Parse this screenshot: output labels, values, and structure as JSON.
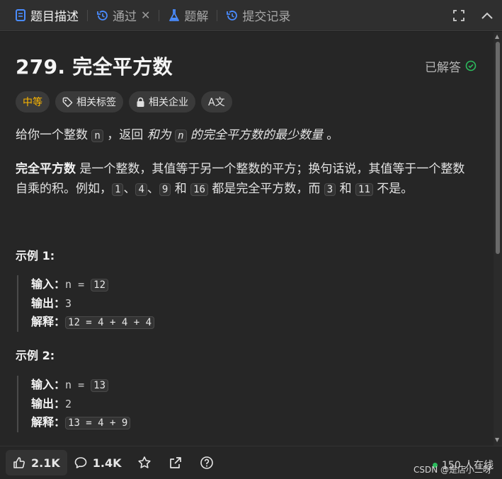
{
  "tabs": [
    {
      "label": "题目描述",
      "icon": "document-icon",
      "active": true
    },
    {
      "label": "通过",
      "icon": "history-icon",
      "active": false
    },
    {
      "label": "题解",
      "icon": "flask-icon",
      "active": false
    },
    {
      "label": "提交记录",
      "icon": "history-icon",
      "active": false
    }
  ],
  "problem": {
    "title": "279. 完全平方数",
    "status": "已解答",
    "tags": [
      {
        "label": "中等",
        "icon": null
      },
      {
        "label": "相关标签",
        "icon": "tag-icon"
      },
      {
        "label": "相关企业",
        "icon": "lock-icon"
      },
      {
        "label": "",
        "icon": "translate-icon",
        "glyph": "A文"
      }
    ],
    "desc1": {
      "p1": "给你一个整数 ",
      "code_n": "n",
      "p2": " ，返回 ",
      "em1": "和为",
      "p3": " ",
      "code_n2": "n",
      "p4": " ",
      "em2": "的完全平方数的最少数量",
      "p5": " 。"
    },
    "desc2": {
      "bold": "完全平方数",
      "p1": " 是一个整数，其值等于另一个整数的平方；换句话说，其值等于一个整数自乘的积。例如，",
      "c1": "1",
      "s1": "、",
      "c2": "4",
      "s2": "、",
      "c3": "9",
      "s3": " 和 ",
      "c4": "16",
      "s4": " 都是完全平方数，而 ",
      "c5": "3",
      "s5": " 和 ",
      "c6": "11",
      "s6": " 不是。"
    },
    "examples": [
      {
        "title": "示例 1:",
        "input_label": "输入：",
        "input_expr": "n = ",
        "input_val": "12",
        "output_label": "输出：",
        "output_val": "3",
        "explain_label": "解释：",
        "explain_val": "12 = 4 + 4 + 4"
      },
      {
        "title": "示例 2:",
        "input_label": "输入：",
        "input_expr": "n = ",
        "input_val": "13",
        "output_label": "输出：",
        "output_val": "2",
        "explain_label": "解释：",
        "explain_val": "13 = 4 + 9"
      }
    ]
  },
  "bottom": {
    "likes": "2.1K",
    "comments": "1.4K",
    "online": "150 人在线",
    "watermark": "CSDN @是店小二呀"
  },
  "colors": {
    "accent_medium": "#ffb800",
    "solved_check": "#2cbb5d",
    "online_dot": "#2cbb5d"
  }
}
